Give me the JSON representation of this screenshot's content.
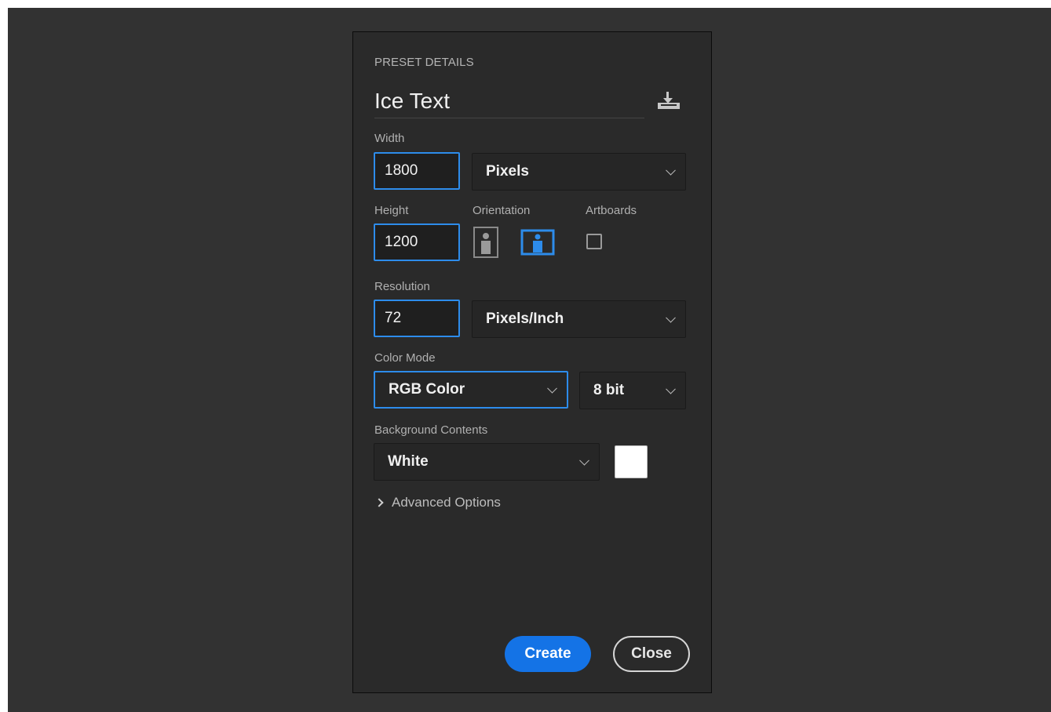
{
  "preset": {
    "section_title": "PRESET DETAILS",
    "name": "Ice Text"
  },
  "width": {
    "label": "Width",
    "value": "1800",
    "unit": "Pixels"
  },
  "height": {
    "label": "Height",
    "value": "1200"
  },
  "orientation": {
    "label": "Orientation",
    "selected": "landscape"
  },
  "artboards": {
    "label": "Artboards",
    "checked": false
  },
  "resolution": {
    "label": "Resolution",
    "value": "72",
    "unit": "Pixels/Inch"
  },
  "color_mode": {
    "label": "Color Mode",
    "mode": "RGB Color",
    "bit_depth": "8 bit"
  },
  "background": {
    "label": "Background Contents",
    "value": "White",
    "swatch_color": "#ffffff"
  },
  "advanced": {
    "label": "Advanced Options"
  },
  "buttons": {
    "create": "Create",
    "close": "Close"
  },
  "colors": {
    "accent": "#1473e6",
    "focus_border": "#2d8ceb",
    "panel_bg": "#2a2a2a"
  },
  "icons": {
    "save_preset": "save-preset-icon",
    "portrait": "portrait-orientation-icon",
    "landscape": "landscape-orientation-icon",
    "dropdown": "chevron-down-icon",
    "expand": "chevron-right-icon"
  }
}
